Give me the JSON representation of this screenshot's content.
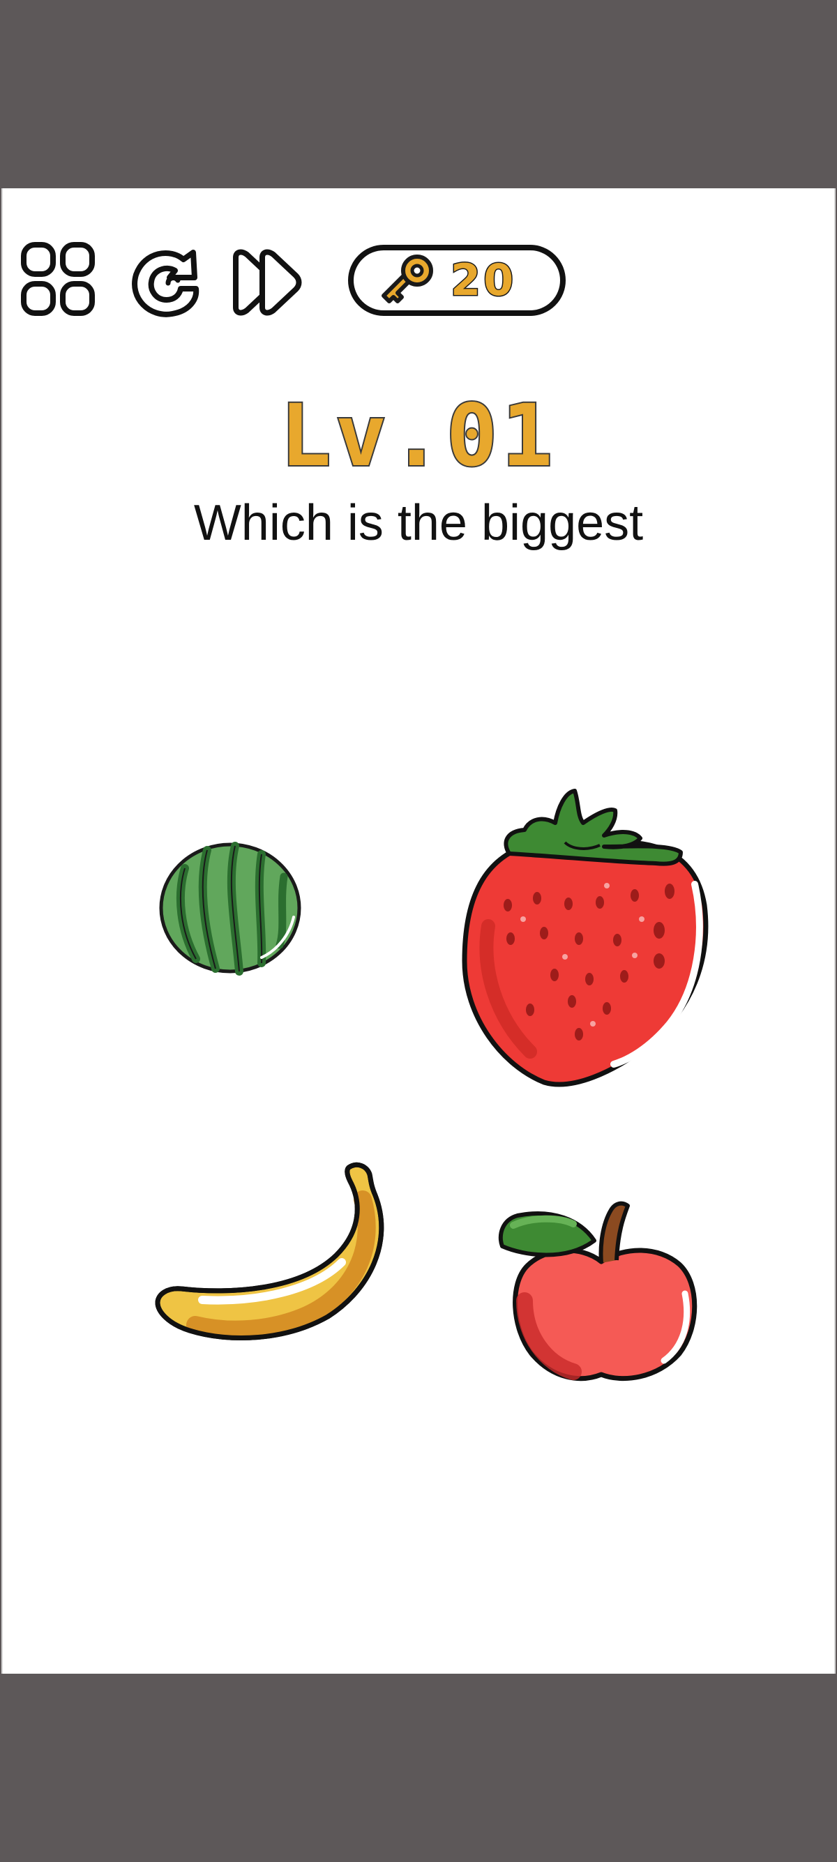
{
  "toolbar": {
    "menu_icon": "grid-menu-icon",
    "restart_icon": "restart-icon",
    "skip_icon": "skip-forward-icon",
    "key_icon": "key-icon",
    "key_count": "20"
  },
  "level": {
    "title": "Lv.01",
    "question": "Which is the biggest"
  },
  "fruits": [
    {
      "name": "watermelon",
      "icon": "watermelon-icon"
    },
    {
      "name": "strawberry",
      "icon": "strawberry-icon"
    },
    {
      "name": "banana",
      "icon": "banana-icon"
    },
    {
      "name": "apple",
      "icon": "apple-icon"
    }
  ],
  "colors": {
    "accent_gold": "#e8a82d",
    "outline": "#1a1a1a",
    "background": "#ffffff",
    "frame": "#5d5859"
  }
}
